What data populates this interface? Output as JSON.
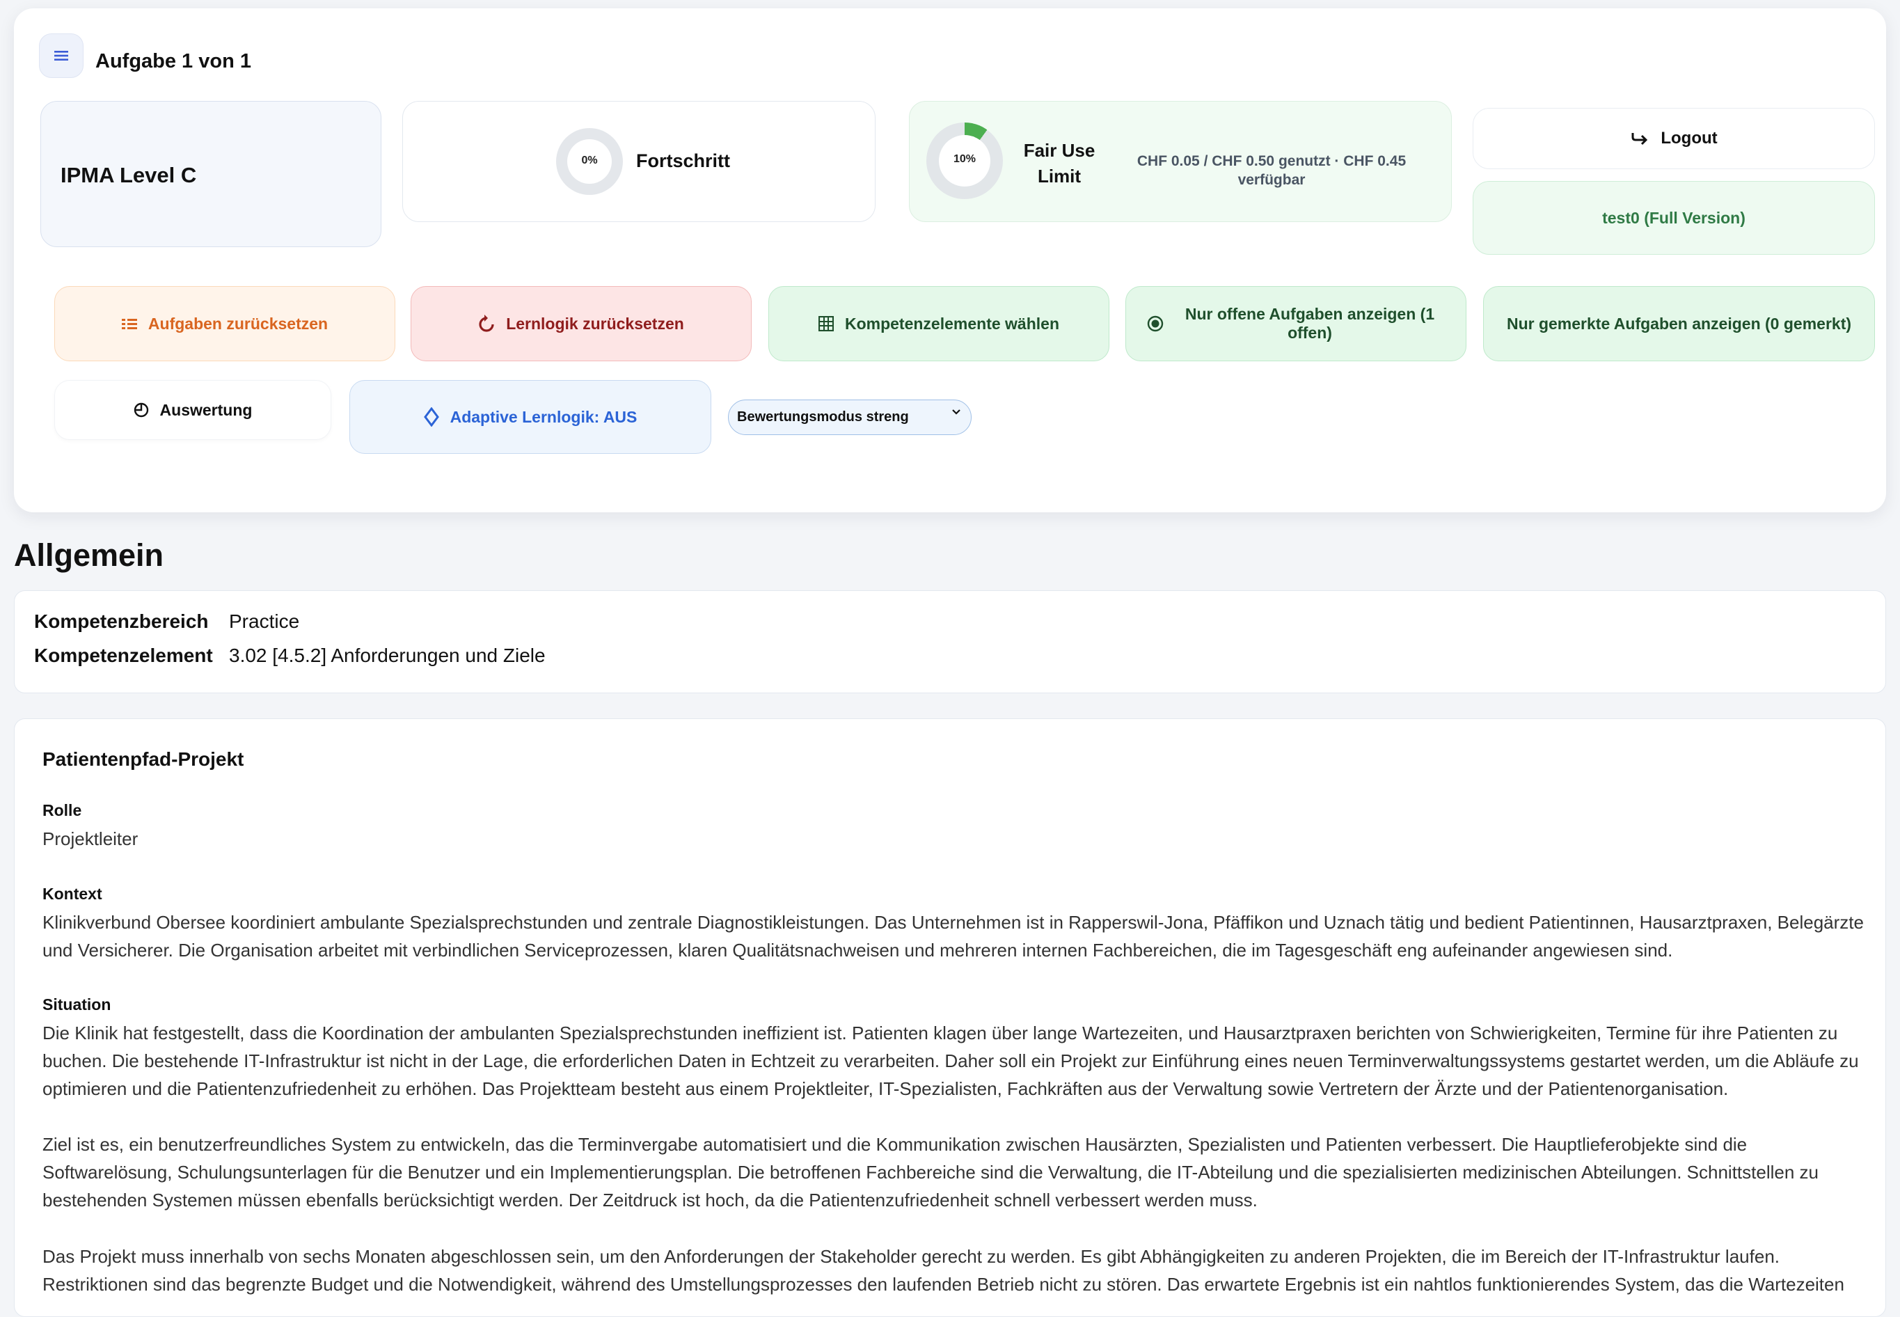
{
  "header": {
    "title": "Aufgabe 1 von 1"
  },
  "level": "IPMA Level C",
  "progress": {
    "percent_label": "0%",
    "label": "Fortschritt"
  },
  "fair_use": {
    "percent_label": "10%",
    "title": "Fair Use Limit",
    "details": "CHF 0.05 / CHF 0.50 genutzt · CHF 0.45 verfügbar"
  },
  "account": {
    "logout_label": "Logout",
    "user_label": "test0 (Full Version)"
  },
  "actions": {
    "reset_tasks": "Aufgaben zurücksetzen",
    "reset_logic": "Lernlogik zurücksetzen",
    "choose_elements": "Kompetenzelemente wählen",
    "open_only": "Nur offene Aufgaben anzeigen (1 offen)",
    "marked_only": "Nur gemerkte Aufgaben anzeigen (0 gemerkt)",
    "evaluation": "Auswertung",
    "adaptive": "Adaptive Lernlogik: AUS",
    "grading_mode": "Bewertungsmodus streng"
  },
  "general": {
    "title": "Allgemein",
    "area_key": "Kompetenzbereich",
    "area_value": "Practice",
    "element_key": "Kompetenzelement",
    "element_value": "3.02 [4.5.2] Anforderungen und Ziele"
  },
  "case": {
    "title": "Patientenpfad-Projekt",
    "role_label": "Rolle",
    "role": "Projektleiter",
    "context_label": "Kontext",
    "context": "Klinikverbund Obersee koordiniert ambulante Spezialsprechstunden und zentrale Diagnostikleistungen. Das Unternehmen ist in Rapperswil-Jona, Pfäffikon und Uznach tätig und bedient Patientinnen, Hausarztpraxen, Belegärzte und Versicherer. Die Organisation arbeitet mit verbindlichen Serviceprozessen, klaren Qualitätsnachweisen und mehreren internen Fachbereichen, die im Tagesgeschäft eng aufeinander angewiesen sind.",
    "situation_label": "Situation",
    "situation_p1": "Die Klinik hat festgestellt, dass die Koordination der ambulanten Spezialsprechstunden ineffizient ist. Patienten klagen über lange Wartezeiten, und Hausarztpraxen berichten von Schwierigkeiten, Termine für ihre Patienten zu buchen. Die bestehende IT-Infrastruktur ist nicht in der Lage, die erforderlichen Daten in Echtzeit zu verarbeiten. Daher soll ein Projekt zur Einführung eines neuen Terminverwaltungssystems gestartet werden, um die Abläufe zu optimieren und die Patientenzufriedenheit zu erhöhen. Das Projektteam besteht aus einem Projektleiter, IT-Spezialisten, Fachkräften aus der Verwaltung sowie Vertretern der Ärzte und der Patientenorganisation.",
    "situation_p2": "Ziel ist es, ein benutzerfreundliches System zu entwickeln, das die Terminvergabe automatisiert und die Kommunikation zwischen Hausärzten, Spezialisten und Patienten verbessert. Die Hauptlieferobjekte sind die Softwarelösung, Schulungsunterlagen für die Benutzer und ein Implementierungsplan. Die betroffenen Fachbereiche sind die Verwaltung, die IT-Abteilung und die spezialisierten medizinischen Abteilungen. Schnittstellen zu bestehenden Systemen müssen ebenfalls berücksichtigt werden. Der Zeitdruck ist hoch, da die Patientenzufriedenheit schnell verbessert werden muss.",
    "situation_p3": "Das Projekt muss innerhalb von sechs Monaten abgeschlossen sein, um den Anforderungen der Stakeholder gerecht zu werden. Es gibt Abhängigkeiten zu anderen Projekten, die im Bereich der IT-Infrastruktur laufen. Restriktionen sind das begrenzte Budget und die Notwendigkeit, während des Umstellungsprozesses den laufenden Betrieb nicht zu stören. Das erwartete Ergebnis ist ein nahtlos funktionierendes System, das die Wartezeiten"
  }
}
